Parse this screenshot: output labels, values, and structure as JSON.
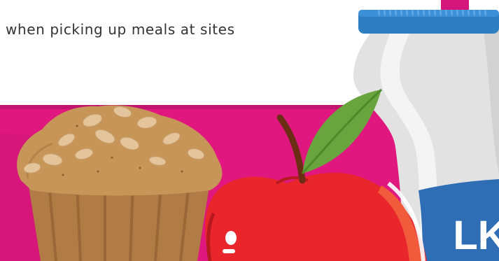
{
  "caption": {
    "text": "when picking up meals at sites"
  },
  "illustration": {
    "items": [
      "muffin",
      "apple",
      "milk-bottle"
    ],
    "bottle_text": "LK"
  },
  "colors": {
    "background_band": "#e0177e",
    "band_shadow": "#9e1b6a",
    "muffin": "#c79558",
    "apple": "#e8262b",
    "leaf": "#6aa43f",
    "bottle": "#e8e8e8",
    "cap": "#2f7ec2",
    "label": "#2f6eb5"
  }
}
